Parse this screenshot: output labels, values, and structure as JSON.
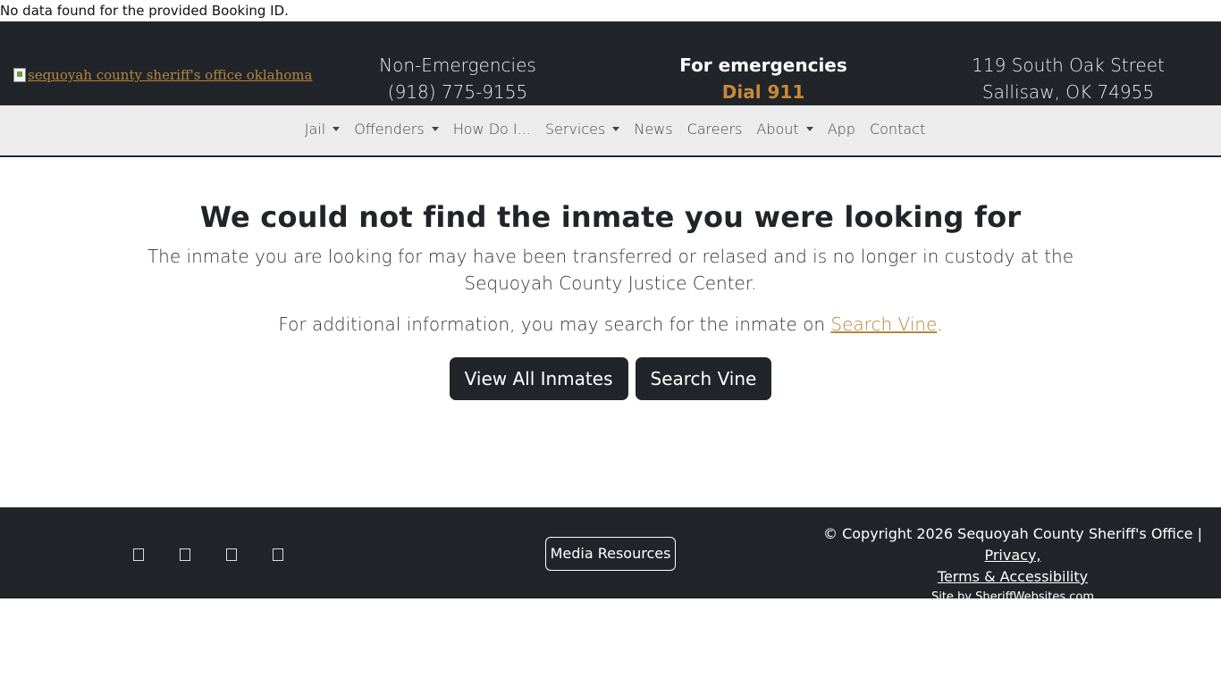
{
  "top_note": "No data found for the provided Booking ID.",
  "header": {
    "logo_alt": "sequoyah county sheriff's office oklahoma",
    "non_emergency_label": "Non-Emergencies",
    "non_emergency_phone": "(918) 775-9155",
    "emergency_label": "For emergencies",
    "emergency_dial": "Dial 911",
    "address_line1": "119 South Oak Street",
    "address_line2": "Sallisaw, OK 74955"
  },
  "nav": {
    "jail": "Jail",
    "offenders": "Offenders",
    "how_do_i": "How Do I...",
    "services": "Services",
    "news": "News",
    "careers": "Careers",
    "about": "About",
    "app": "App",
    "contact": "Contact"
  },
  "main": {
    "heading": "We could not find the inmate you were looking for",
    "lead": "The inmate you are looking for may have been transferred or relased and is no longer in custody at the Sequoyah County Justice Center.",
    "more_prefix": "For additional information, you may search for the inmate on ",
    "more_link": "Search Vine",
    "more_suffix": ".",
    "btn_view_all": "View All Inmates",
    "btn_search_vine": "Search Vine"
  },
  "footer": {
    "social_icons": [
      "social-icon-1",
      "social-icon-2",
      "social-icon-3",
      "social-icon-4"
    ],
    "media_resources": "Media Resources",
    "copyright": "© Copyright 2026 Sequoyah County Sheriff's Office | ",
    "privacy": "Privacy,",
    "terms": "Terms & Accessibility",
    "site_by": "Site by SheriffWebsites.com"
  },
  "colors": {
    "header_bg": "#212529",
    "accent": "#c8893a",
    "nav_bg": "#ececec"
  }
}
